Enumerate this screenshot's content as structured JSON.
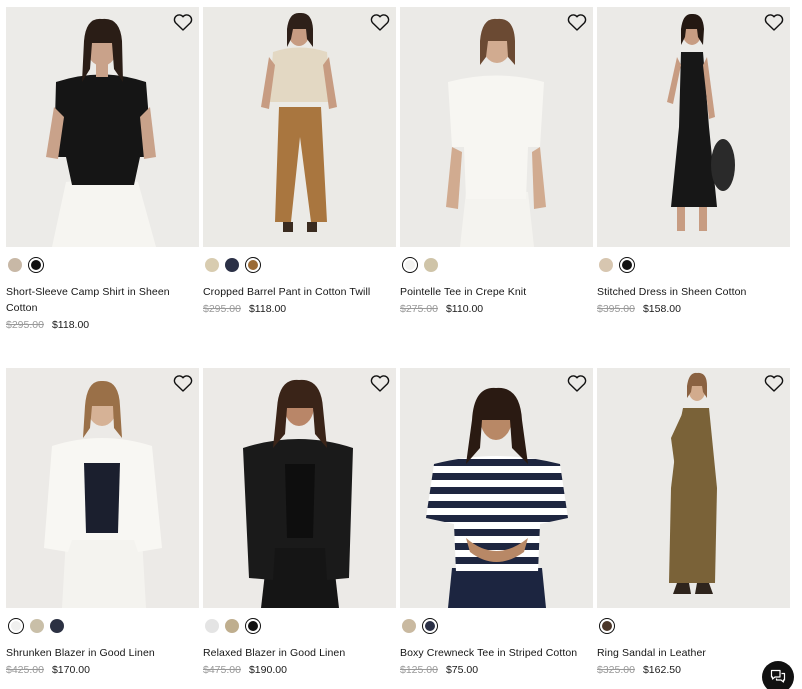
{
  "products": [
    {
      "name": "Short-Sleeve Camp Shirt in Sheen Cotton",
      "original_price": "$295.00",
      "sale_price": "$118.00",
      "swatches": [
        {
          "color": "#c8b8a6",
          "selected": false
        },
        {
          "color": "#111111",
          "selected": true
        }
      ],
      "icon": "heart-icon"
    },
    {
      "name": "Cropped Barrel Pant in Cotton Twill",
      "original_price": "$295.00",
      "sale_price": "$118.00",
      "swatches": [
        {
          "color": "#d8ccb0",
          "selected": false
        },
        {
          "color": "#2b3046",
          "selected": false
        },
        {
          "color": "#9a6a35",
          "selected": true
        }
      ],
      "icon": "heart-icon"
    },
    {
      "name": "Pointelle Tee in Crepe Knit",
      "original_price": "$275.00",
      "sale_price": "$110.00",
      "swatches": [
        {
          "color": "#f2f2f0",
          "selected": true
        },
        {
          "color": "#cfc4a8",
          "selected": false
        }
      ],
      "icon": "heart-icon"
    },
    {
      "name": "Stitched Dress in Sheen Cotton",
      "original_price": "$395.00",
      "sale_price": "$158.00",
      "swatches": [
        {
          "color": "#d7c6b0",
          "selected": false
        },
        {
          "color": "#111111",
          "selected": true
        }
      ],
      "icon": "heart-icon"
    },
    {
      "name": "Shrunken Blazer in Good Linen",
      "original_price": "$425.00",
      "sale_price": "$170.00",
      "swatches": [
        {
          "color": "#f0f0ef",
          "selected": true
        },
        {
          "color": "#c9bfa8",
          "selected": false
        },
        {
          "color": "#2c3143",
          "selected": false
        }
      ],
      "icon": "heart-icon"
    },
    {
      "name": "Relaxed Blazer in Good Linen",
      "original_price": "$475.00",
      "sale_price": "$190.00",
      "swatches": [
        {
          "color": "#e4e4e4",
          "selected": false
        },
        {
          "color": "#bfae8e",
          "selected": false
        },
        {
          "color": "#111111",
          "selected": true
        }
      ],
      "icon": "heart-icon"
    },
    {
      "name": "Boxy Crewneck Tee in Striped Cotton",
      "original_price": "$125.00",
      "sale_price": "$75.00",
      "swatches": [
        {
          "color": "#c9b9a0",
          "selected": false
        },
        {
          "color": "#2b3046",
          "selected": true
        }
      ],
      "icon": "heart-icon"
    },
    {
      "name": "Ring Sandal in Leather",
      "original_price": "$325.00",
      "sale_price": "$162.50",
      "swatches": [
        {
          "color": "#4a3628",
          "selected": true
        }
      ],
      "icon": "heart-icon"
    }
  ],
  "chat": {
    "icon": "chat-icon"
  },
  "colors": {
    "text": "#151515",
    "strike": "#9a9a9a",
    "photo_bg": "#ececea"
  }
}
